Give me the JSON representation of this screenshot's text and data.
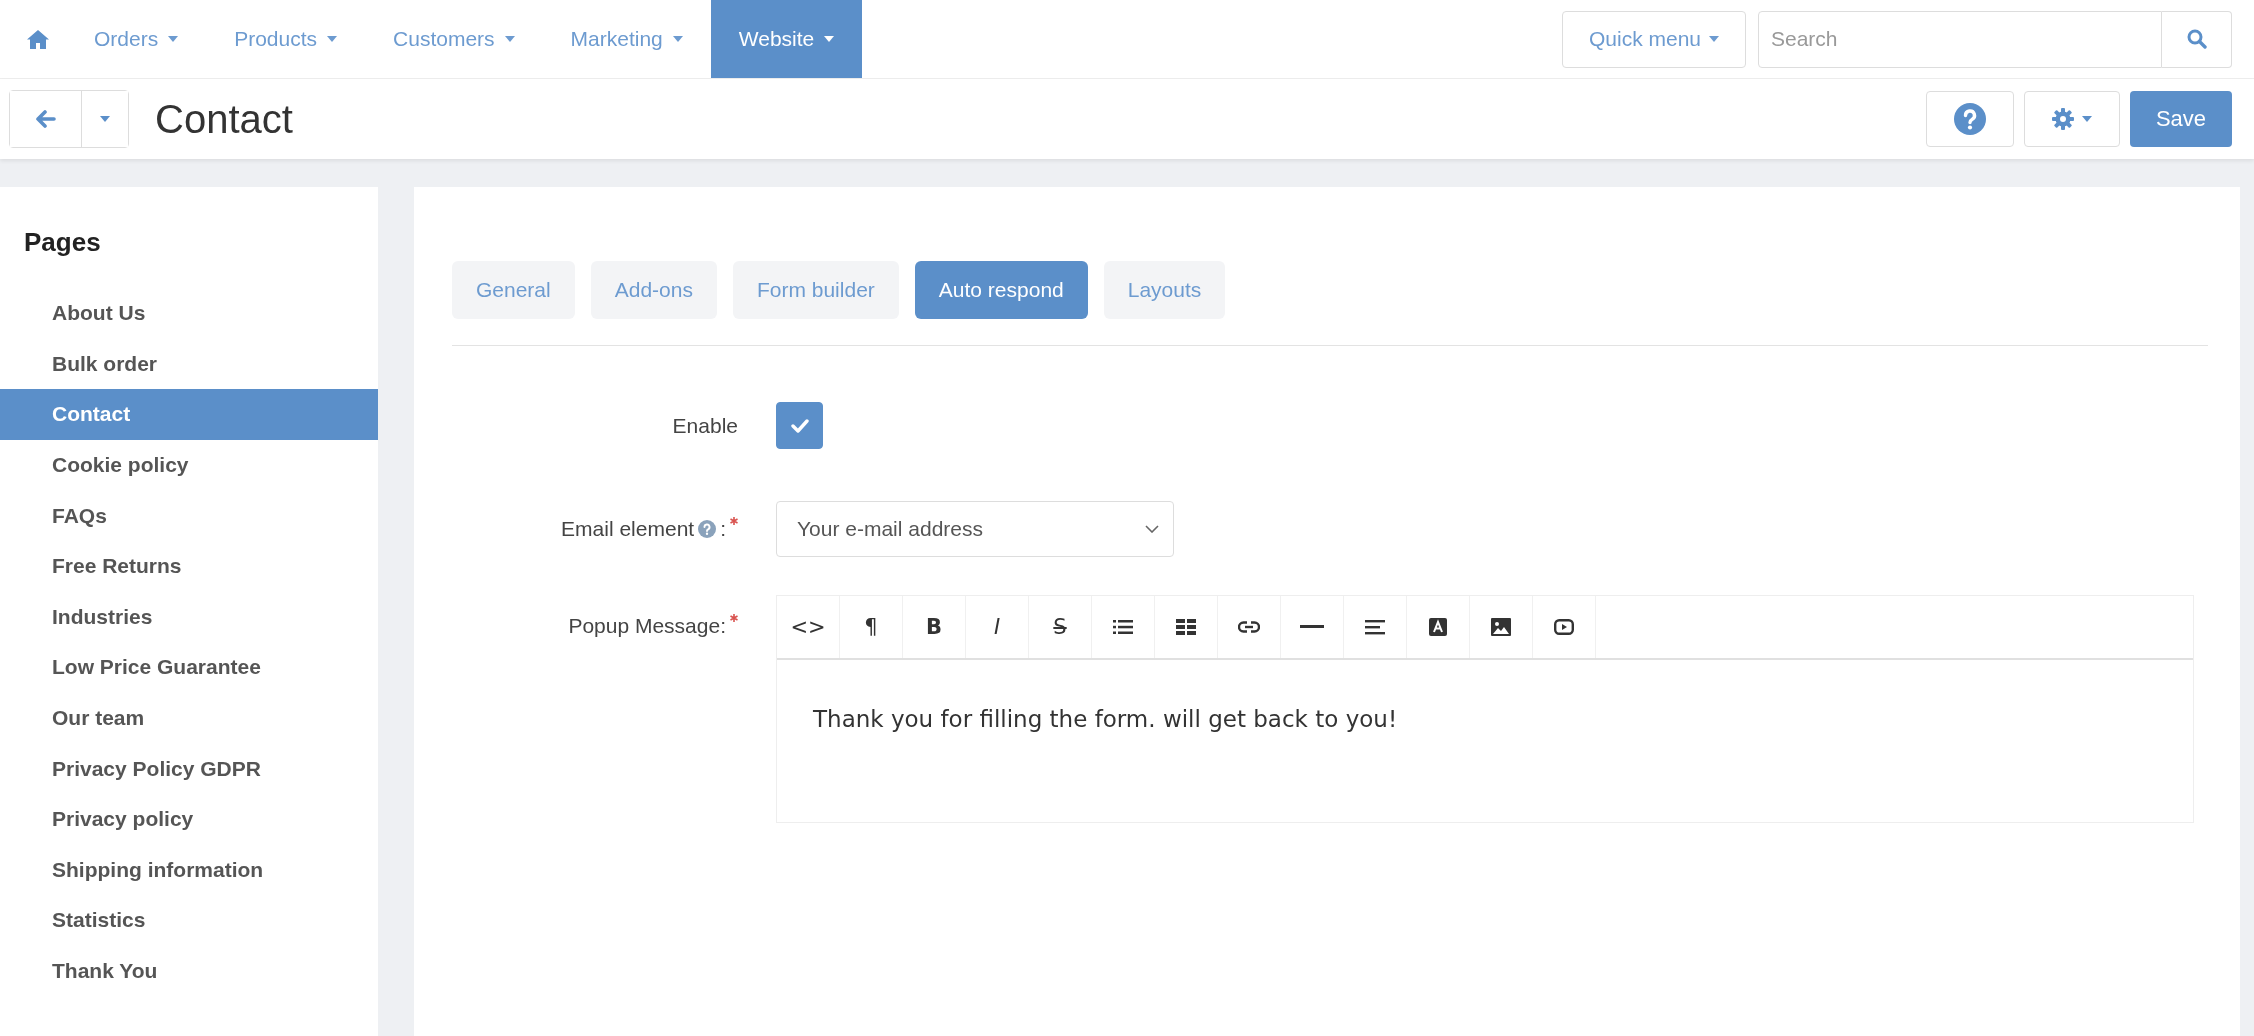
{
  "nav": {
    "items": [
      {
        "label": "Orders",
        "selected": false
      },
      {
        "label": "Products",
        "selected": false
      },
      {
        "label": "Customers",
        "selected": false
      },
      {
        "label": "Marketing",
        "selected": false
      },
      {
        "label": "Website",
        "selected": true
      }
    ],
    "quick_menu": "Quick menu",
    "search": {
      "placeholder": "Search"
    }
  },
  "header": {
    "title": "Contact",
    "save": "Save"
  },
  "sidebar": {
    "title": "Pages",
    "items": [
      {
        "label": "About Us",
        "selected": false
      },
      {
        "label": "Bulk order",
        "selected": false
      },
      {
        "label": "Contact",
        "selected": true
      },
      {
        "label": "Cookie policy",
        "selected": false
      },
      {
        "label": "FAQs",
        "selected": false
      },
      {
        "label": "Free Returns",
        "selected": false
      },
      {
        "label": "Industries",
        "selected": false
      },
      {
        "label": "Low Price Guarantee",
        "selected": false
      },
      {
        "label": "Our team",
        "selected": false
      },
      {
        "label": "Privacy Policy GDPR",
        "selected": false
      },
      {
        "label": "Privacy policy",
        "selected": false
      },
      {
        "label": "Shipping information",
        "selected": false
      },
      {
        "label": "Statistics",
        "selected": false
      },
      {
        "label": "Thank You",
        "selected": false
      }
    ]
  },
  "tabs": [
    {
      "label": "General",
      "selected": false
    },
    {
      "label": "Add-ons",
      "selected": false
    },
    {
      "label": "Form builder",
      "selected": false
    },
    {
      "label": "Auto respond",
      "selected": true
    },
    {
      "label": "Layouts",
      "selected": false
    }
  ],
  "form": {
    "enable": {
      "label": "Enable",
      "checked": true
    },
    "email_element": {
      "label": "Email element",
      "suffix": ":",
      "required": true,
      "value": "Your e-mail address"
    },
    "popup_message": {
      "label": "Popup Message:",
      "required": true,
      "toolbar": [
        {
          "kind": "code",
          "label": "<>"
        },
        {
          "kind": "paragraph",
          "label": "¶"
        },
        {
          "kind": "bold",
          "label": "B"
        },
        {
          "kind": "italic",
          "label": "I"
        },
        {
          "kind": "strike",
          "label": "S"
        },
        {
          "kind": "list"
        },
        {
          "kind": "table"
        },
        {
          "kind": "link"
        },
        {
          "kind": "rule"
        },
        {
          "kind": "align"
        },
        {
          "kind": "color"
        },
        {
          "kind": "image"
        },
        {
          "kind": "video"
        }
      ],
      "value": "Thank you for filling the form. will get back to you!"
    }
  }
}
